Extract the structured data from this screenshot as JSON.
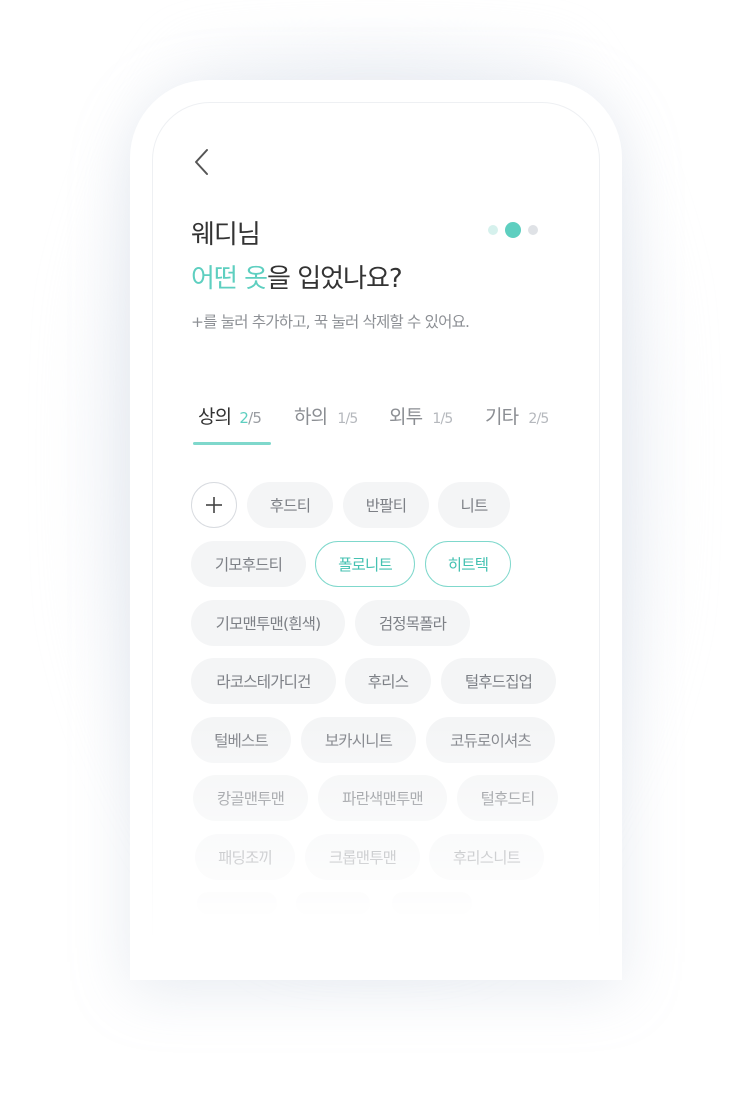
{
  "header": {
    "back_icon": "chevron-left-icon",
    "greeting": "웨디님",
    "question_highlight": "어떤 옷",
    "question_rest": "을 입었나요?",
    "hint": "+를 눌러 추가하고, 꾹 눌러 삭제할 수 있어요."
  },
  "progress": {
    "steps": 3,
    "current": 2
  },
  "colors": {
    "accent": "#5ecfc0",
    "accent_border": "#7fd8cc",
    "chip_bg": "#f4f5f6",
    "text_main": "#333333"
  },
  "tabs": [
    {
      "label": "상의",
      "count": "2",
      "total": "/5"
    },
    {
      "label": "하의",
      "count": "1/5"
    },
    {
      "label": "외투",
      "count": "1/5"
    },
    {
      "label": "기타",
      "count": "2/5"
    }
  ],
  "chips": {
    "add_symbol": "+",
    "items": [
      "후드티",
      "반팔티",
      "니트",
      "기모후드티",
      "폴로니트",
      "히트텍",
      "기모맨투맨(흰색)",
      "검정목폴라",
      "라코스테가디건",
      "후리스",
      "털후드집업",
      "털베스트",
      "보카시니트",
      "코듀로이셔츠",
      "캉골맨투맨",
      "파란색맨투맨",
      "털후드티",
      "패딩조끼",
      "크롭맨투맨",
      "후리스니트"
    ],
    "selected": [
      "폴로니트",
      "히트텍"
    ]
  }
}
